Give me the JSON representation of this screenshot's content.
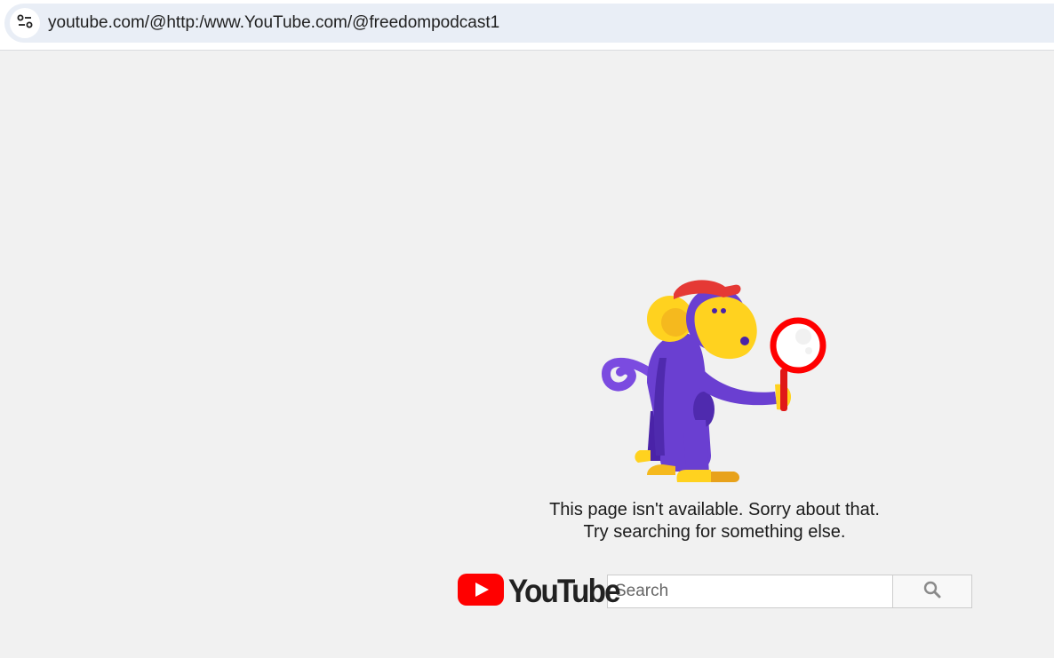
{
  "browser": {
    "url": "youtube.com/@http:/www.YouTube.com/@freedompodcast1",
    "site_info_icon": "tune-icon"
  },
  "error": {
    "line1": "This page isn't available. Sorry about that.",
    "line2": "Try searching for something else."
  },
  "search": {
    "logo_text": "YouTube",
    "placeholder": "Search",
    "button_icon": "search-icon"
  },
  "colors": {
    "youtube_red": "#ff0000",
    "monkey_purple": "#6a3fd1",
    "monkey_yellow": "#ffd21f",
    "page_background": "#f1f1f1"
  }
}
